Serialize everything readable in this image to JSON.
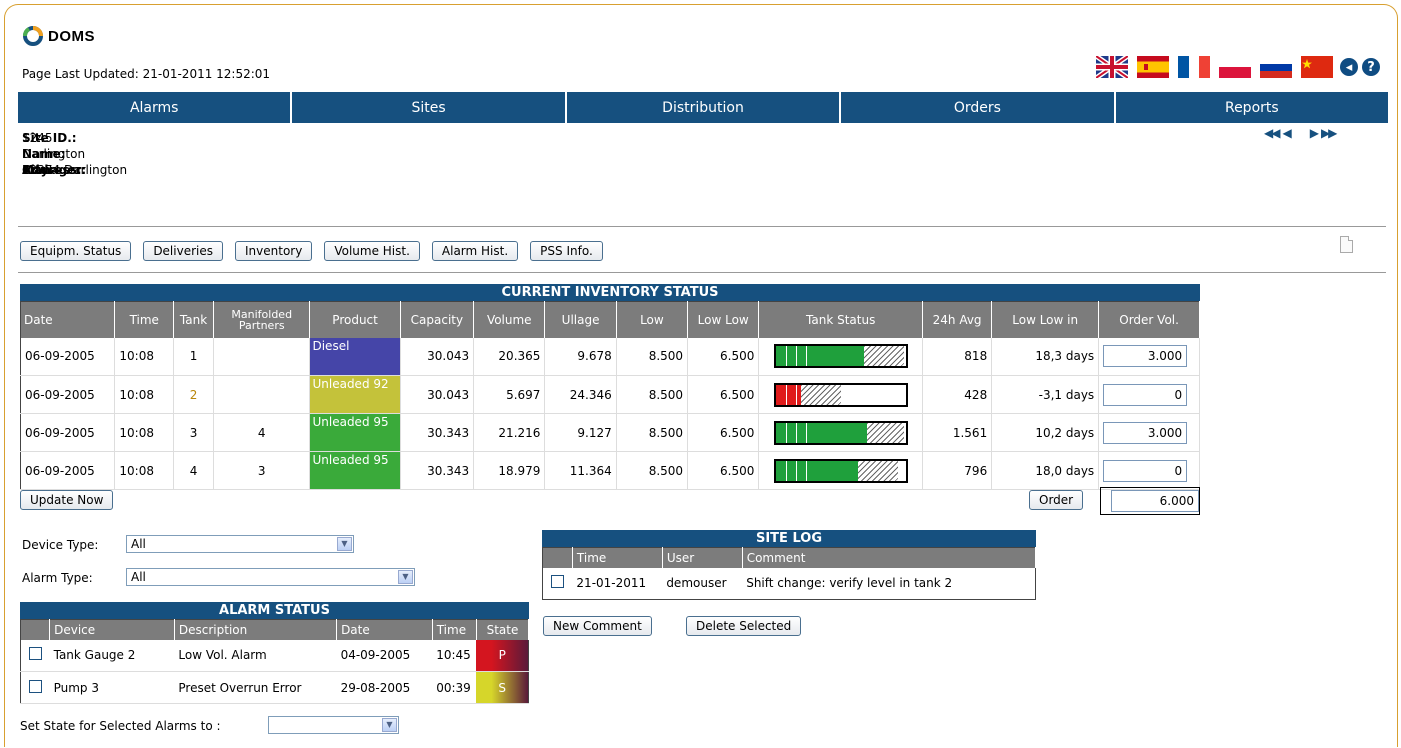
{
  "app": {
    "brand": "DOMS",
    "last_updated": "Page Last Updated: 21-01-2011 12:52:01"
  },
  "languages": [
    "English",
    "Spanish",
    "French",
    "Polish",
    "Russian",
    "Chinese"
  ],
  "icons": {
    "back": "back-icon",
    "help": "help-icon",
    "document": "document-icon"
  },
  "nav": [
    "Alarms",
    "Sites",
    "Distribution",
    "Orders",
    "Reports"
  ],
  "pager": {
    "first": "◀◀",
    "prev": "◀",
    "next": "▶",
    "last": "▶▶"
  },
  "site": {
    "labels": {
      "id": "Site ID.:",
      "name": "Name:",
      "manager": "Manager:",
      "address": "Address:",
      "city": "City:"
    },
    "id": "1245",
    "name": "Darlington",
    "manager": "",
    "address": "",
    "city": "12374 Darlington"
  },
  "tabs": [
    "Equipm. Status",
    "Deliveries",
    "Inventory",
    "Volume Hist.",
    "Alarm Hist.",
    "PSS Info."
  ],
  "inventory": {
    "caption": "CURRENT INVENTORY STATUS",
    "headers": [
      "Date",
      "Time",
      "Tank",
      "Manifolded Partners",
      "Product",
      "Capacity",
      "Volume",
      "Ullage",
      "Low",
      "Low Low",
      "Tank Status",
      "24h Avg",
      "Low Low in",
      "Order Vol."
    ],
    "rows": [
      {
        "date": "06-09-2005",
        "time": "10:08",
        "tank": "1",
        "partners": "",
        "product": "Diesel",
        "product_color": "#4545a8",
        "capacity": "30.043",
        "volume": "20.365",
        "ullage": "9.678",
        "low": "8.500",
        "lowlow": "6.500",
        "fill_fraction": 0.68,
        "fill_color": "#1fa03c",
        "avg": "818",
        "lowlow_in": "18,3 days",
        "order": "3.000"
      },
      {
        "date": "06-09-2005",
        "time": "10:08",
        "tank": "2",
        "tank_color": "#b8860b",
        "partners": "",
        "product": "Unleaded 92",
        "product_color": "#c4c23a",
        "capacity": "30.043",
        "volume": "5.697",
        "ullage": "24.346",
        "low": "8.500",
        "lowlow": "6.500",
        "fill_fraction": 0.19,
        "fill_color": "#e01b1b",
        "avg": "428",
        "lowlow_in": "-3,1 days",
        "order": "0"
      },
      {
        "date": "06-09-2005",
        "time": "10:08",
        "tank": "3",
        "partners": "4",
        "product": "Unleaded 95",
        "product_color": "#3aaa3a",
        "capacity": "30.343",
        "volume": "21.216",
        "ullage": "9.127",
        "low": "8.500",
        "lowlow": "6.500",
        "fill_fraction": 0.7,
        "fill_color": "#1fa03c",
        "avg": "1.561",
        "lowlow_in": "10,2 days",
        "order": "3.000"
      },
      {
        "date": "06-09-2005",
        "time": "10:08",
        "tank": "4",
        "partners": "3",
        "product": "Unleaded 95",
        "product_color": "#3aaa3a",
        "capacity": "30.343",
        "volume": "18.979",
        "ullage": "11.364",
        "low": "8.500",
        "lowlow": "6.500",
        "fill_fraction": 0.63,
        "fill_color": "#1fa03c",
        "avg": "796",
        "lowlow_in": "18,0 days",
        "order": "0"
      }
    ],
    "update_label": "Update Now",
    "order_label": "Order",
    "order_total": "6.000"
  },
  "filters": {
    "device_type_label": "Device Type:",
    "device_type_value": "All",
    "alarm_type_label": "Alarm Type:",
    "alarm_type_value": "All"
  },
  "alarms": {
    "caption": "ALARM STATUS",
    "headers": [
      "Device",
      "Description",
      "Date",
      "Time",
      "State"
    ],
    "rows": [
      {
        "device": "Tank Gauge 2",
        "description": "Low Vol. Alarm",
        "date": "04-09-2005",
        "time": "10:45",
        "state": "P",
        "state_color": "#d4151f"
      },
      {
        "device": "Pump 3",
        "description": "Preset Overrun Error",
        "date": "29-08-2005",
        "time": "00:39",
        "state": "S",
        "state_color": "#d6d62a"
      }
    ],
    "set_state_label": "Set State for Selected Alarms to :"
  },
  "sitelog": {
    "caption": "SITE LOG",
    "headers": [
      "Time",
      "User",
      "Comment"
    ],
    "rows": [
      {
        "time": "21-01-2011",
        "user": "demouser",
        "comment": "Shift change: verify level in tank 2"
      }
    ],
    "new_label": "New Comment",
    "delete_label": "Delete Selected"
  }
}
